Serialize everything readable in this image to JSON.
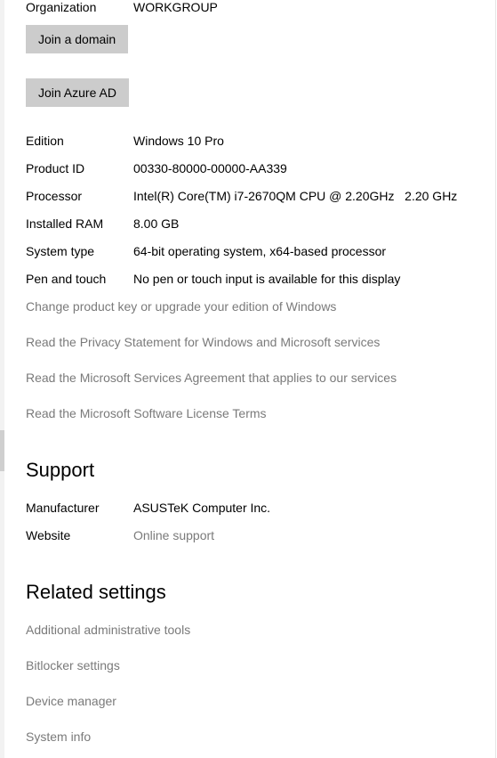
{
  "top_row": {
    "label": "Organization",
    "value": "WORKGROUP"
  },
  "buttons": {
    "join_domain": "Join a domain",
    "join_azure": "Join Azure AD"
  },
  "specs": [
    {
      "label": "Edition",
      "value": "Windows 10 Pro"
    },
    {
      "label": "Product ID",
      "value": "00330-80000-00000-AA339"
    },
    {
      "label": "Processor",
      "value": "Intel(R) Core(TM) i7-2670QM CPU @ 2.20GHz   2.20 GHz"
    },
    {
      "label": "Installed RAM",
      "value": "8.00 GB"
    },
    {
      "label": "System type",
      "value": "64-bit operating system, x64-based processor"
    },
    {
      "label": "Pen and touch",
      "value": "No pen or touch input is available for this display"
    }
  ],
  "links": {
    "change_key": "Change product key or upgrade your edition of Windows",
    "privacy": "Read the Privacy Statement for Windows and Microsoft services",
    "services_agreement": "Read the Microsoft Services Agreement that applies to our services",
    "license_terms": "Read the Microsoft Software License Terms"
  },
  "support": {
    "heading": "Support",
    "manufacturer_label": "Manufacturer",
    "manufacturer_value": "ASUSTeK Computer Inc.",
    "website_label": "Website",
    "website_value": "Online support"
  },
  "related": {
    "heading": "Related settings",
    "items": [
      "Additional administrative tools",
      "Bitlocker settings",
      "Device manager",
      "System info"
    ]
  }
}
